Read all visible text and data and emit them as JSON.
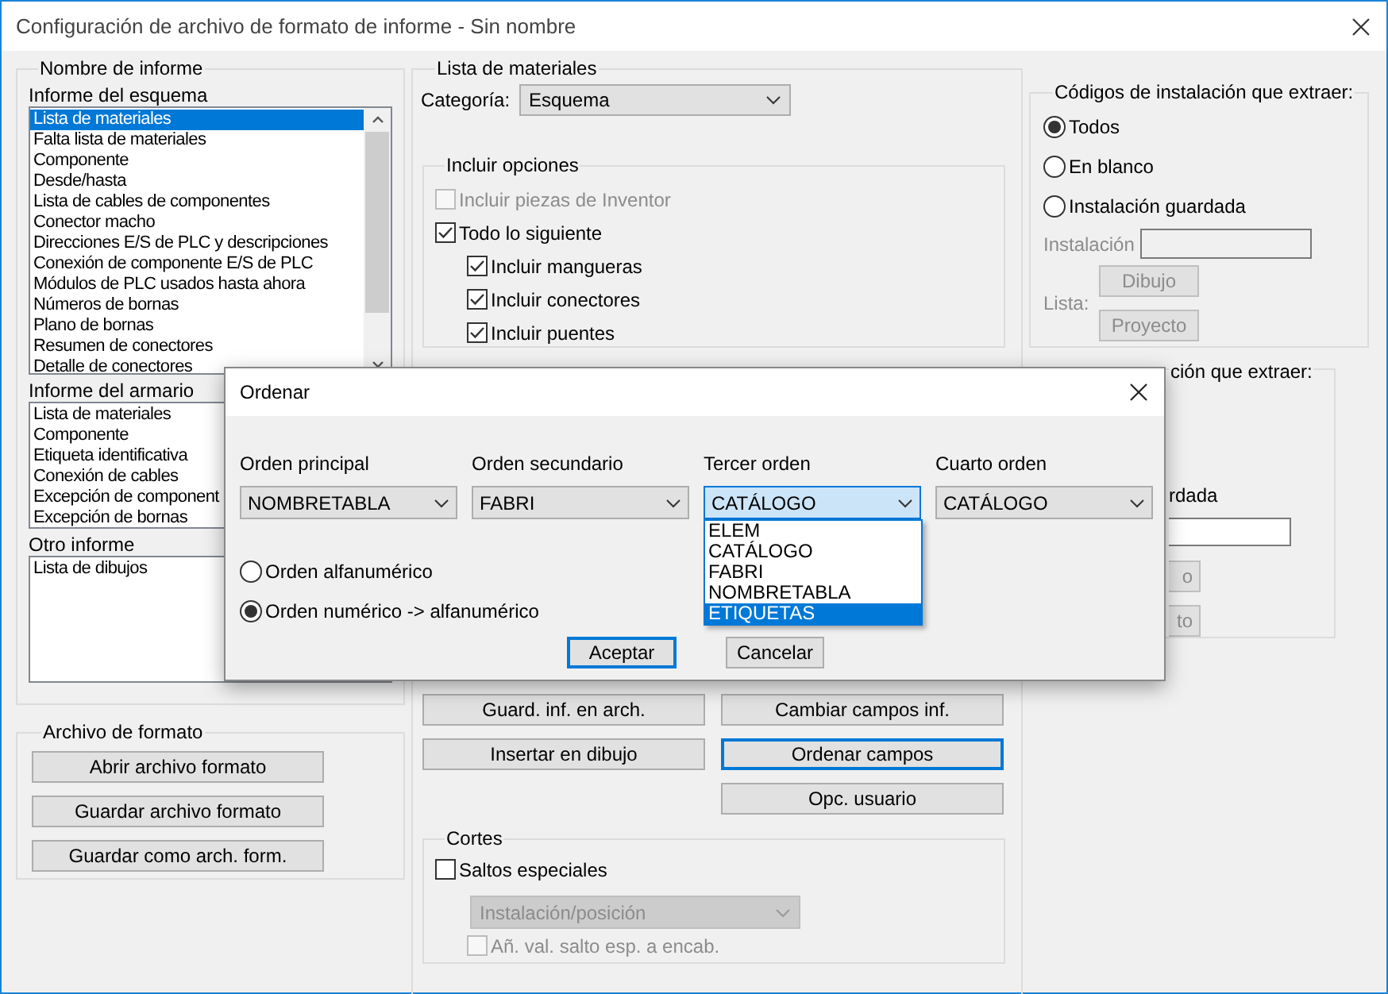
{
  "window": {
    "title": "Configuración de archivo de formato de informe - Sin nombre"
  },
  "report_names": {
    "title": "Nombre de informe",
    "lists": [
      {
        "label": "Informe del esquema",
        "scrollable": true,
        "items": [
          {
            "text": "Lista de materiales",
            "selected": true
          },
          {
            "text": "Falta lista de materiales",
            "selected": false
          },
          {
            "text": "Componente",
            "selected": false
          },
          {
            "text": "Desde/hasta",
            "selected": false
          },
          {
            "text": "Lista de cables de componentes",
            "selected": false
          },
          {
            "text": "Conector macho",
            "selected": false
          },
          {
            "text": "Direcciones E/S de PLC y descripciones",
            "selected": false
          },
          {
            "text": "Conexión de componente E/S de PLC",
            "selected": false
          },
          {
            "text": "Módulos de PLC usados hasta ahora",
            "selected": false
          },
          {
            "text": "Números de bornas",
            "selected": false
          },
          {
            "text": "Plano de bornas",
            "selected": false
          },
          {
            "text": "Resumen de conectores",
            "selected": false
          },
          {
            "text": "Detalle de conectores",
            "selected": false
          }
        ]
      },
      {
        "label": "Informe del armario",
        "items": [
          {
            "text": "Lista de materiales",
            "selected": false
          },
          {
            "text": "Componente",
            "selected": false
          },
          {
            "text": "Etiqueta identificativa",
            "selected": false
          },
          {
            "text": "Conexión de cables",
            "selected": false
          },
          {
            "text": "Excepción de component",
            "selected": false
          },
          {
            "text": "Excepción de bornas",
            "selected": false
          }
        ]
      },
      {
        "label": "Otro informe",
        "items": [
          {
            "text": "Lista de dibujos",
            "selected": false
          }
        ]
      }
    ]
  },
  "format_file": {
    "title": "Archivo de formato",
    "buttons": [
      "Abrir archivo formato",
      "Guardar archivo formato",
      "Guardar como arch. form."
    ]
  },
  "bom": {
    "title": "Lista de materiales",
    "category_label": "Categoría:",
    "category_value": "Esquema",
    "include": {
      "title": "Incluir opciones",
      "options": [
        {
          "label": "Incluir piezas de Inventor",
          "checked": false,
          "disabled": true
        },
        {
          "label": "Todo lo siguiente",
          "checked": true,
          "disabled": false,
          "children": [
            {
              "label": "Incluir mangueras",
              "checked": true,
              "disabled": false
            },
            {
              "label": "Incluir conectores",
              "checked": true,
              "disabled": false
            },
            {
              "label": "Incluir puentes",
              "checked": true,
              "disabled": false
            }
          ]
        }
      ]
    },
    "buttons": [
      {
        "label": "Guard. inf. en arch.",
        "focused": false
      },
      {
        "label": "Cambiar campos inf.",
        "focused": false
      },
      {
        "label": "Insertar en dibujo",
        "focused": false
      },
      {
        "label": "Ordenar campos",
        "focused": true
      },
      {
        "label": "Opc. usuario",
        "focused": false
      }
    ],
    "breaks": {
      "title": "Cortes",
      "special": {
        "label": "Saltos especiales",
        "checked": false,
        "disabled": false
      },
      "select": {
        "value": "Instalación/posición",
        "disabled": true
      },
      "header": {
        "label": "Añ. val. salto esp. a encab.",
        "checked": false,
        "disabled": true
      }
    }
  },
  "install_codes": {
    "title": "Códigos de instalación que extraer:",
    "options": [
      {
        "label": "Todos",
        "selected": true
      },
      {
        "label": "En blanco",
        "selected": false
      },
      {
        "label": "Instalación guardada",
        "selected": false
      }
    ],
    "field_label": "Instalación",
    "list_label": "Lista:",
    "buttons": [
      {
        "label": "Dibujo",
        "disabled": true
      },
      {
        "label": "Proyecto",
        "disabled": true
      }
    ]
  },
  "location_codes": {
    "title": "ción que extraer:",
    "option_label": "rdada",
    "buttons": [
      {
        "label": "o",
        "disabled": true
      },
      {
        "label": "to",
        "disabled": true
      }
    ]
  },
  "sort_dialog": {
    "title": "Ordenar",
    "columns": [
      {
        "label": "Orden principal",
        "value": "NOMBRETABLA",
        "focused": false
      },
      {
        "label": "Orden secundario",
        "value": "FABRI",
        "focused": false
      },
      {
        "label": "Tercer orden",
        "value": "CATÁLOGO",
        "focused": true
      },
      {
        "label": "Cuarto orden",
        "value": "CATÁLOGO",
        "focused": false
      }
    ],
    "dropdown": {
      "items": [
        {
          "text": "ELEM",
          "selected": false
        },
        {
          "text": "CATÁLOGO",
          "selected": false
        },
        {
          "text": "FABRI",
          "selected": false
        },
        {
          "text": "NOMBRETABLA",
          "selected": false
        },
        {
          "text": "ETIQUETAS",
          "selected": true
        }
      ]
    },
    "options": [
      {
        "label": "Orden alfanumérico",
        "selected": false
      },
      {
        "label": "Orden numérico -> alfanumérico",
        "selected": true
      }
    ],
    "buttons": [
      {
        "label": "Aceptar",
        "default": true
      },
      {
        "label": "Cancelar",
        "default": false
      }
    ]
  }
}
